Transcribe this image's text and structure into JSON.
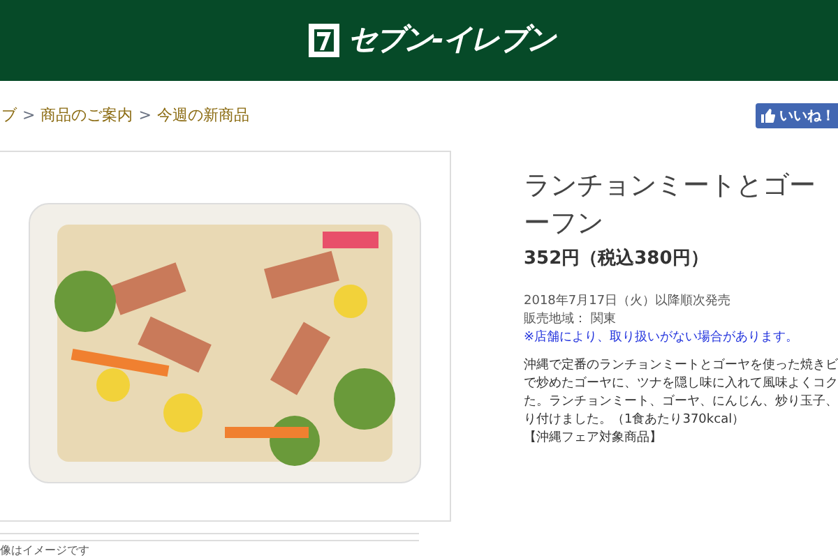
{
  "header": {
    "logo_text": "セブン-イレブン"
  },
  "breadcrumb": [
    {
      "label": "ブ"
    },
    {
      "label": "商品のご案内"
    },
    {
      "label": "今週の新商品"
    }
  ],
  "breadcrumb_separator": ">",
  "like_button": {
    "label": "いいね！"
  },
  "product": {
    "title_lines": [
      "ランチョンミートとゴー",
      "ーフン"
    ],
    "price": "352円（税込380円）",
    "release": "2018年7月17日（火）以降順次発売",
    "region": "販売地域： 関東",
    "notice": "※店舗により、取り扱いがない場合があります。",
    "description_lines": [
      "沖縄で定番のランチョンミートとゴーヤを使った焼きビ",
      "で炒めたゴーヤに、ツナを隠し味に入れて風味よくコク",
      "た。ランチョンミート、ゴーヤ、にんじん、炒り玉子、",
      "り付けました。（1食あたり370kcal）",
      "【沖縄フェア対象商品】"
    ]
  },
  "image_caption": "像はイメージです"
}
